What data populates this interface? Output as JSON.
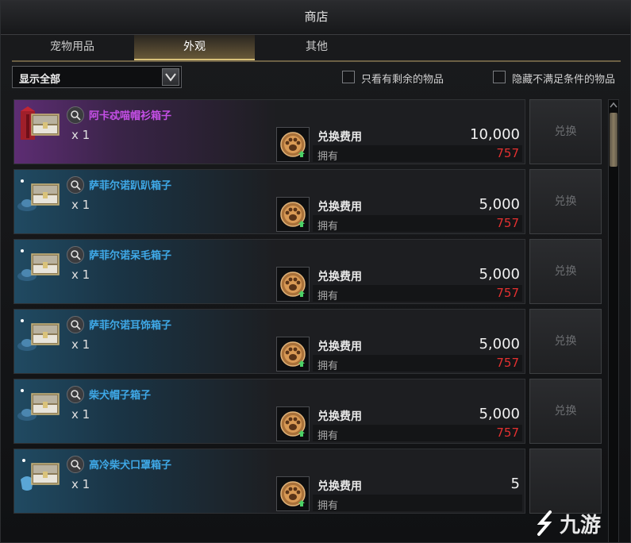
{
  "window": {
    "title": "商店"
  },
  "tabs": [
    {
      "label": "宠物用品",
      "active": false
    },
    {
      "label": "外观",
      "active": true
    },
    {
      "label": "其他",
      "active": false
    }
  ],
  "filters": {
    "dropdown_value": "显示全部",
    "checkbox_remaining": {
      "label": "只看有剩余的物品",
      "checked": false
    },
    "checkbox_hide_unmet": {
      "label": "隐藏不满足条件的物品",
      "checked": false
    }
  },
  "items": [
    {
      "name": "阿卡忒喵帽衫箱子",
      "qty": "x 1",
      "cost_label": "兑换费用",
      "cost": "10,000",
      "owned_label": "拥有",
      "owned": "757",
      "button": "兑换",
      "rarity_color": "#c54fe6",
      "bg": "purple",
      "icon": "chest-hoodie-icon"
    },
    {
      "name": "萨菲尔诺趴趴箱子",
      "qty": "x 1",
      "cost_label": "兑换费用",
      "cost": "5,000",
      "owned_label": "拥有",
      "owned": "757",
      "button": "兑换",
      "rarity_color": "#3fa9e8",
      "bg": "blue",
      "icon": "chest-hat-icon"
    },
    {
      "name": "萨菲尔诺呆毛箱子",
      "qty": "x 1",
      "cost_label": "兑换费用",
      "cost": "5,000",
      "owned_label": "拥有",
      "owned": "757",
      "button": "兑换",
      "rarity_color": "#3fa9e8",
      "bg": "blue",
      "icon": "chest-hat-icon"
    },
    {
      "name": "萨菲尔诺耳饰箱子",
      "qty": "x 1",
      "cost_label": "兑换费用",
      "cost": "5,000",
      "owned_label": "拥有",
      "owned": "757",
      "button": "兑换",
      "rarity_color": "#3fa9e8",
      "bg": "blue",
      "icon": "chest-hat-icon"
    },
    {
      "name": "柴犬帽子箱子",
      "qty": "x 1",
      "cost_label": "兑换费用",
      "cost": "5,000",
      "owned_label": "拥有",
      "owned": "757",
      "button": "兑换",
      "rarity_color": "#3fa9e8",
      "bg": "blue",
      "icon": "chest-hat-icon"
    },
    {
      "name": "高冷柴犬口罩箱子",
      "qty": "x 1",
      "cost_label": "兑换费用",
      "cost": "5",
      "owned_label": "拥有",
      "owned": "",
      "button": "",
      "rarity_color": "#3fa9e8",
      "bg": "blue",
      "icon": "chest-mask-icon"
    }
  ],
  "watermark": "九游",
  "colors": {
    "accent_gold": "#d9c27a",
    "owned_red": "#e33030"
  }
}
